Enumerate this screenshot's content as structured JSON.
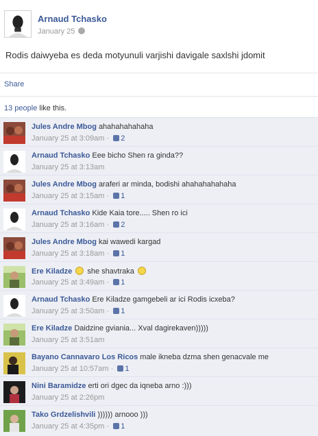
{
  "post": {
    "author": "Arnaud Tchasko",
    "date": "January 25",
    "text": "Rodis daiwyeba es deda motyunuli varjishi davigale saxlshi jdomit",
    "share_label": "Share",
    "likes_count_text": "13 people",
    "likes_suffix": " like this."
  },
  "comments": [
    {
      "author": "Jules Andre Mbog",
      "text": "ahahahahahaha",
      "time": "January 25 at 3:09am",
      "likes": "2",
      "avatar": "couple-photo"
    },
    {
      "author": "Arnaud Tchasko",
      "text": "Eee bicho Shen ra ginda??",
      "time": "January 25 at 3:13am",
      "likes": "",
      "avatar": "portrait"
    },
    {
      "author": "Jules Andre Mbog",
      "text": "araferi ar minda, bodishi ahahahahahaha",
      "time": "January 25 at 3:15am",
      "likes": "1",
      "avatar": "couple-photo"
    },
    {
      "author": "Arnaud Tchasko",
      "text": "Kide Kaia tore..... Shen ro ici",
      "time": "January 25 at 3:16am",
      "likes": "2",
      "avatar": "portrait"
    },
    {
      "author": "Jules Andre Mbog",
      "text": "kai wawedi kargad",
      "time": "January 25 at 3:18am",
      "likes": "1",
      "avatar": "couple-photo"
    },
    {
      "author": "Ere Kiladze",
      "text_before": "",
      "text": "she shavtraka",
      "time": "January 25 at 3:49am",
      "likes": "1",
      "avatar": "outdoor-photo"
    },
    {
      "author": "Arnaud Tchasko",
      "text": "Ere Kiladze gamgebeli ar ici Rodis icxeba?",
      "time": "January 25 at 3:50am",
      "likes": "1",
      "avatar": "portrait"
    },
    {
      "author": "Ere Kiladze",
      "text": "Daidzine gviania... Xval dagirekaven)))))",
      "time": "January 25 at 3:51am",
      "likes": "",
      "avatar": "outdoor-photo"
    },
    {
      "author": "Bayano Cannavaro Los Ricos",
      "text": "male ikneba dzma shen genacvale me",
      "time": "January 25 at 10:57am",
      "likes": "1",
      "avatar": "yellow-photo"
    },
    {
      "author": "Nini Baramidze",
      "text": "erti ori dgec da iqneba arno :)))",
      "time": "January 25 at 2:26pm",
      "likes": "",
      "avatar": "dark-photo"
    },
    {
      "author": "Tako Grdzelishvili",
      "text": ")))))) arnooo )))",
      "time": "January 25 at 4:35pm",
      "likes": "1",
      "avatar": "green-photo"
    }
  ],
  "colors": {
    "link": "#3b5998",
    "muted": "#999999",
    "comments_bg": "#edeff4"
  }
}
